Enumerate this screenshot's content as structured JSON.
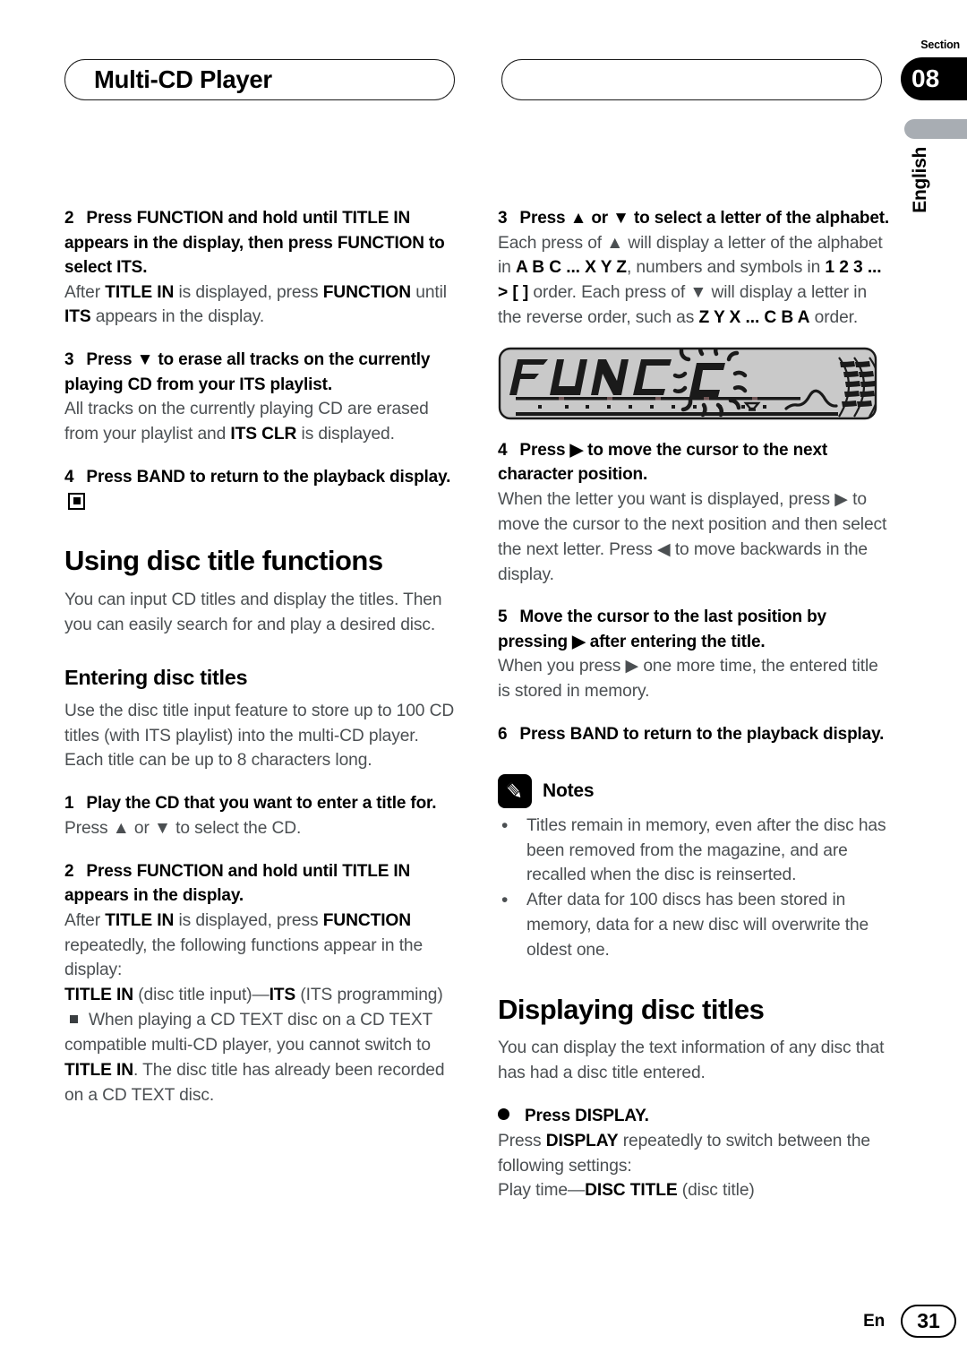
{
  "header": {
    "title": "Multi-CD Player",
    "section_label": "Section",
    "section_number": "08",
    "language": "English"
  },
  "left_column": {
    "step2": {
      "num": "2",
      "title_a": "Press FUNCTION and hold until TITLE IN appears in the display, then press FUNCTION to select ITS.",
      "body_1": "After ",
      "body_b1": "TITLE IN",
      "body_2": " is displayed, press ",
      "body_b2": "FUNCTION",
      "body_3": " until ",
      "body_b3": "ITS",
      "body_4": " appears in the display."
    },
    "step3": {
      "num": "3",
      "title": "Press ▼ to erase all tracks on the currently playing CD from your ITS playlist.",
      "body_1": "All tracks on the currently playing CD are erased from your playlist and ",
      "body_b1": "ITS CLR",
      "body_2": " is displayed."
    },
    "step4": {
      "num": "4",
      "title": "Press BAND to return to the playback display."
    },
    "h1_using": "Using disc title functions",
    "using_body": "You can input CD titles and display the titles. Then you can easily search for and play a desired disc.",
    "h2_entering": "Entering disc titles",
    "entering_body": "Use the disc title input feature to store up to 100 CD titles  (with ITS playlist) into the multi-CD player. Each title can be up to 8 characters long.",
    "step1": {
      "num": "1",
      "title": "Play the CD that you want to enter a title for.",
      "body": "Press ▲ or ▼ to select the CD."
    },
    "step2b": {
      "num": "2",
      "title": "Press FUNCTION and hold until TITLE IN appears in the display.",
      "body_1": "After ",
      "body_b1": "TITLE IN",
      "body_2": " is displayed, press ",
      "body_b2": "FUNCTION",
      "body_3": " repeatedly, the following functions appear in the display:",
      "line_b1": "TITLE IN",
      "line_2": " (disc title input)—",
      "line_b2": "ITS",
      "line_3": " (ITS programming)",
      "note_1": "When playing a CD TEXT disc on a CD TEXT compatible multi-CD player, you cannot switch to ",
      "note_b1": "TITLE IN",
      "note_2": ". The disc title has already been recorded on a CD TEXT disc."
    }
  },
  "right_column": {
    "step3": {
      "num": "3",
      "title": "Press ▲ or ▼ to select a letter of the alphabet.",
      "body_1": "Each press of ▲ will display a letter of the alphabet in ",
      "body_b1": "A B C ... X Y Z",
      "body_2": ", numbers and symbols in ",
      "body_b2": "1 2 3 ... > [ ]",
      "body_3": " order. Each press of ▼ will display a letter in the reverse order, such as ",
      "body_b3": "Z Y X ... C B A",
      "body_4": " order."
    },
    "lcd": {
      "text": "FUNC",
      "blinking_char": "C"
    },
    "step4": {
      "num": "4",
      "title": "Press ▶ to move the cursor to the next character position.",
      "body": "When the letter you want is displayed, press ▶ to move the cursor to the next position and then select the next letter. Press ◀ to move backwards in the display."
    },
    "step5": {
      "num": "5",
      "title": "Move the cursor to the last position by pressing ▶ after entering the title.",
      "body": "When you press ▶ one more time, the entered title is stored in memory."
    },
    "step6": {
      "num": "6",
      "title": "Press BAND to return to the playback display."
    },
    "notes": {
      "heading": "Notes",
      "items": [
        "Titles remain in memory, even after the disc has been removed from the magazine, and are recalled when the disc is reinserted.",
        "After data for 100 discs has been stored in memory, data for a new disc will overwrite the oldest one."
      ]
    },
    "h1_displaying": "Displaying disc titles",
    "displaying_body": "You can display the text information of any disc that has had a disc title entered.",
    "press_display": {
      "title": "Press DISPLAY.",
      "body_1": "Press ",
      "body_b1": "DISPLAY",
      "body_2": " repeatedly to switch between the following settings:",
      "line_1": "Play time—",
      "line_b1": "DISC TITLE",
      "line_2": " (disc title)"
    }
  },
  "footer": {
    "lang_code": "En",
    "page_number": "31"
  }
}
